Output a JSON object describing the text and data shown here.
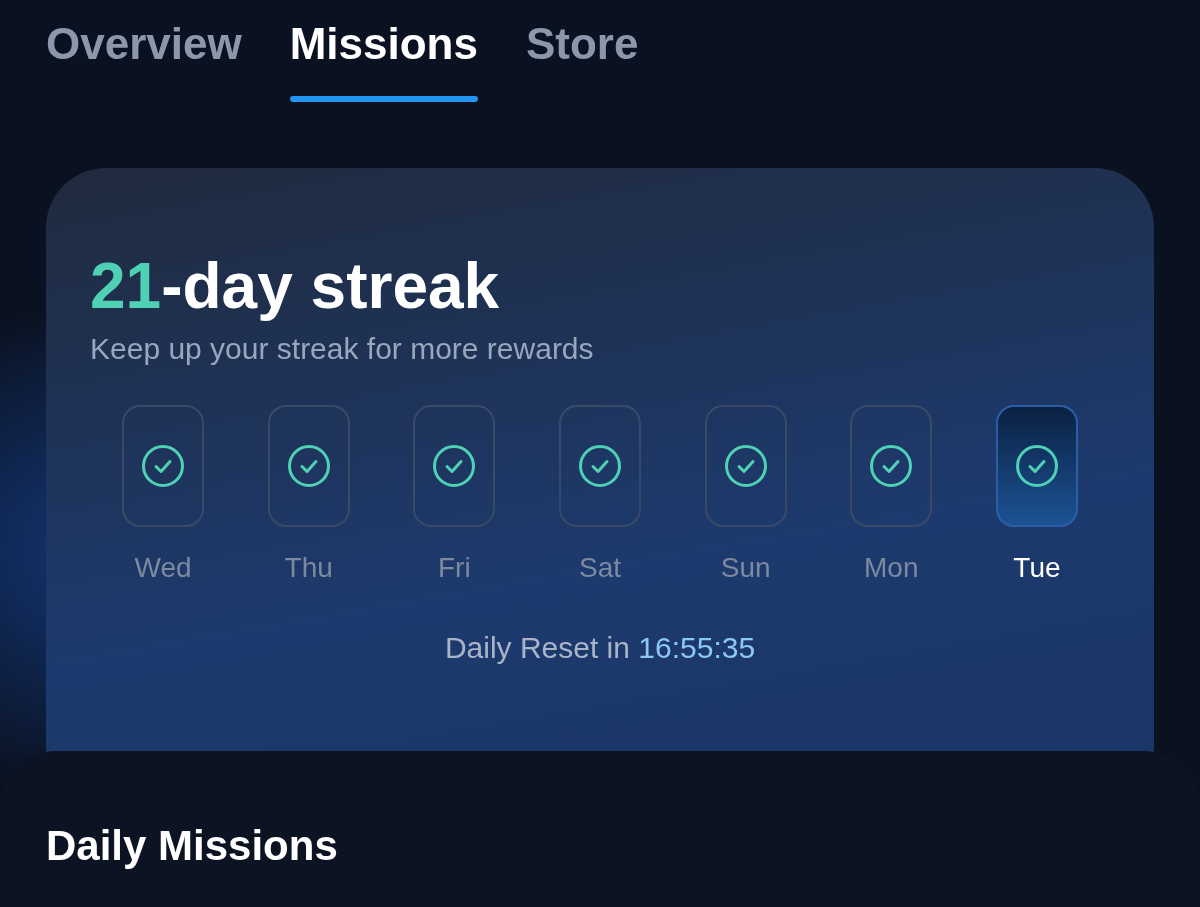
{
  "tabs": [
    {
      "label": "Overview",
      "selected": false
    },
    {
      "label": "Missions",
      "selected": true
    },
    {
      "label": "Store",
      "selected": false
    }
  ],
  "streak": {
    "count": "21",
    "title_rest": "-day streak",
    "subtitle": "Keep up your streak for more rewards"
  },
  "days": [
    {
      "label": "Wed",
      "checked": true,
      "selected": false
    },
    {
      "label": "Thu",
      "checked": true,
      "selected": false
    },
    {
      "label": "Fri",
      "checked": true,
      "selected": false
    },
    {
      "label": "Sat",
      "checked": true,
      "selected": false
    },
    {
      "label": "Sun",
      "checked": true,
      "selected": false
    },
    {
      "label": "Mon",
      "checked": true,
      "selected": false
    },
    {
      "label": "Tue",
      "checked": true,
      "selected": true
    }
  ],
  "reset": {
    "label": "Daily Reset in",
    "time": "16:55:35"
  },
  "section": {
    "title": "Daily Missions"
  }
}
